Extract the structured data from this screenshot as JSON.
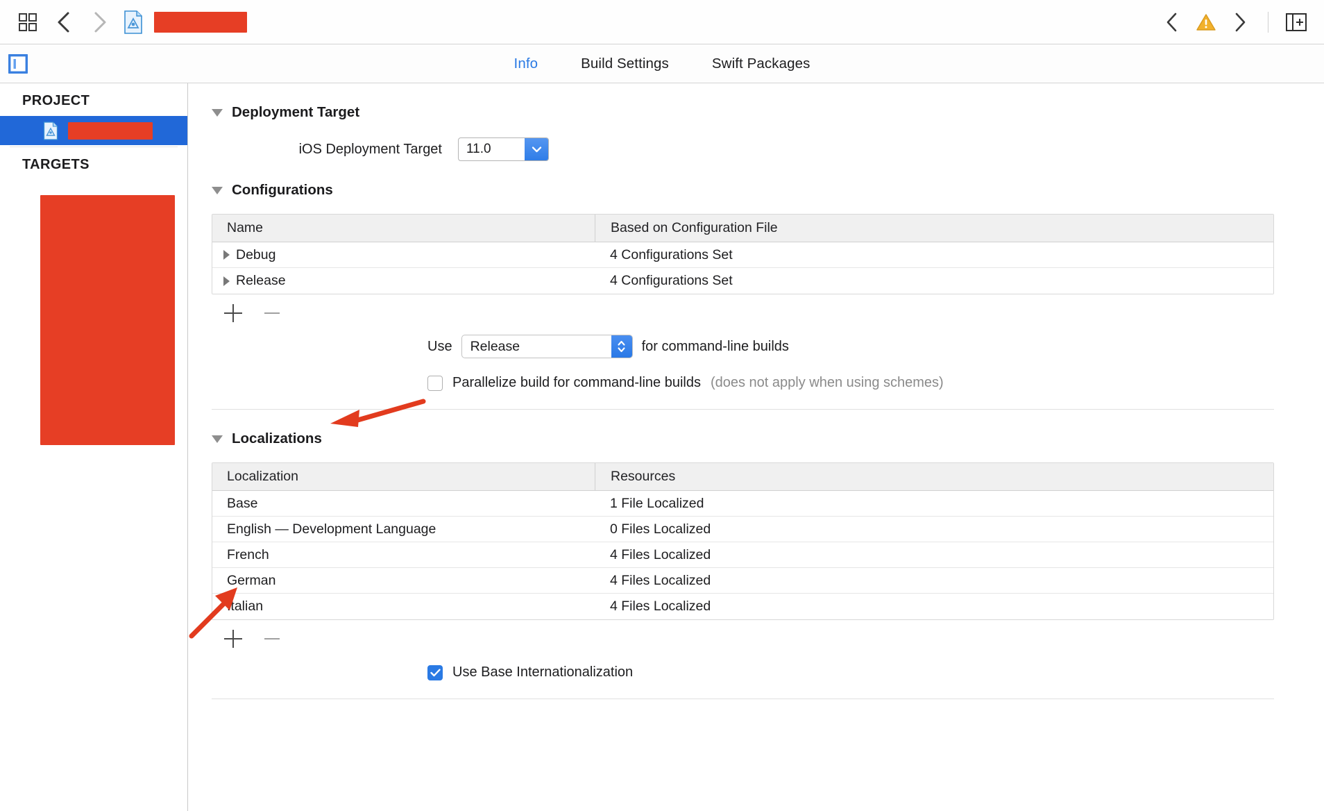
{
  "toolbar": {
    "scheme_icon": "grid-icon",
    "back_label": "<",
    "forward_label": ">",
    "document_icon": "xcode-project-icon",
    "title_redacted": "",
    "warning_icon": "warning-triangle-icon",
    "panel_toggle_icon": "inspector-toggle-icon"
  },
  "tabs": [
    {
      "label": "Info",
      "active": true
    },
    {
      "label": "Build Settings",
      "active": false
    },
    {
      "label": "Swift Packages",
      "active": false
    }
  ],
  "sidebar": {
    "project_header": "PROJECT",
    "targets_header": "TARGETS",
    "project_item_redacted": "",
    "target_item_redacted": ""
  },
  "deployment": {
    "section_title": "Deployment Target",
    "field_label": "iOS Deployment Target",
    "value": "11.0"
  },
  "configurations": {
    "section_title": "Configurations",
    "columns": [
      "Name",
      "Based on Configuration File"
    ],
    "rows": [
      {
        "name": "Debug",
        "based_on": "4 Configurations Set"
      },
      {
        "name": "Release",
        "based_on": "4 Configurations Set"
      }
    ],
    "add_label": "+",
    "remove_label": "−",
    "use_prefix": "Use",
    "use_value": "Release",
    "use_suffix": "for command-line builds",
    "parallelize_label": "Parallelize build for command-line builds",
    "parallelize_note": "(does not apply when using schemes)",
    "parallelize_checked": false
  },
  "localizations": {
    "section_title": "Localizations",
    "columns": [
      "Localization",
      "Resources"
    ],
    "rows": [
      {
        "language": "Base",
        "resources": "1 File Localized"
      },
      {
        "language": "English — Development Language",
        "resources": "0 Files Localized"
      },
      {
        "language": "French",
        "resources": "4 Files Localized"
      },
      {
        "language": "German",
        "resources": "4 Files Localized"
      },
      {
        "language": "Italian",
        "resources": "4 Files Localized"
      }
    ],
    "add_label": "+",
    "remove_label": "−",
    "base_intl_label": "Use Base Internationalization",
    "base_intl_checked": true
  },
  "annotations": {
    "arrow_color": "#e23b1e",
    "arrow_localizations_target": "Localizations",
    "arrow_add_target": "+"
  },
  "colors": {
    "accent_blue": "#2a7ae4",
    "selection_blue": "#2168d8",
    "redaction_red": "#e63e25",
    "annotation_red": "#e23b1e",
    "warning_yellow": "#f2b12c"
  }
}
